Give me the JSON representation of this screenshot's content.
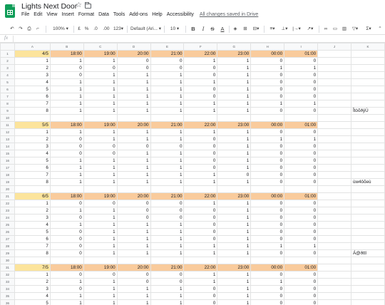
{
  "app": {
    "title": "Lights Next Door",
    "saved_status": "All changes saved in Drive",
    "menu": [
      "File",
      "Edit",
      "View",
      "Insert",
      "Format",
      "Data",
      "Tools",
      "Add-ons",
      "Help",
      "Accessibility"
    ]
  },
  "toolbar": {
    "zoom": "100%",
    "currency": "£",
    "percent": "%",
    "dec_less": ".0",
    "dec_more": ".00",
    "more_formats": "123",
    "font": "Default (Ari...",
    "font_size": "10",
    "bold": "B",
    "italic": "I",
    "strike": "S",
    "text_color": "A"
  },
  "formula_bar": {
    "label": "fx",
    "value": ""
  },
  "columns": [
    "A",
    "B",
    "C",
    "D",
    "E",
    "F",
    "G",
    "H",
    "I",
    "J",
    "K"
  ],
  "rows": [
    [
      "4/5",
      "18:00",
      "19:00",
      "20:00",
      "21:00",
      "22:00",
      "23:00",
      "00:00",
      "01:00",
      "",
      ""
    ],
    [
      "1",
      "1",
      "1",
      "0",
      "0",
      "1",
      "1",
      "0",
      "0",
      "",
      ""
    ],
    [
      "2",
      "0",
      "0",
      "0",
      "0",
      "0",
      "1",
      "1",
      "1",
      "",
      ""
    ],
    [
      "3",
      "0",
      "1",
      "1",
      "1",
      "0",
      "1",
      "0",
      "0",
      "",
      ""
    ],
    [
      "4",
      "1",
      "1",
      "1",
      "1",
      "1",
      "1",
      "0",
      "0",
      "",
      ""
    ],
    [
      "5",
      "1",
      "1",
      "1",
      "1",
      "0",
      "1",
      "0",
      "0",
      "",
      ""
    ],
    [
      "6",
      "1",
      "1",
      "1",
      "1",
      "0",
      "1",
      "0",
      "0",
      "",
      ""
    ],
    [
      "7",
      "1",
      "1",
      "1",
      "1",
      "1",
      "1",
      "1",
      "1",
      "",
      ""
    ],
    [
      "8",
      "1",
      "1",
      "1",
      "1",
      "1",
      "1",
      "0",
      "0",
      "",
      "ÎtòõðÿÙ"
    ],
    [
      "",
      "",
      "",
      "",
      "",
      "",
      "",
      "",
      "",
      "",
      ""
    ],
    [
      "5/5",
      "18:00",
      "19:00",
      "20:00",
      "21:00",
      "22:00",
      "23:00",
      "00:00",
      "01:00",
      "",
      ""
    ],
    [
      "1",
      "1",
      "1",
      "1",
      "1",
      "1",
      "1",
      "0",
      "0",
      "",
      ""
    ],
    [
      "2",
      "0",
      "1",
      "1",
      "1",
      "0",
      "1",
      "1",
      "1",
      "",
      ""
    ],
    [
      "3",
      "0",
      "0",
      "0",
      "0",
      "0",
      "1",
      "0",
      "0",
      "",
      ""
    ],
    [
      "4",
      "0",
      "0",
      "1",
      "1",
      "0",
      "1",
      "0",
      "0",
      "",
      ""
    ],
    [
      "5",
      "1",
      "1",
      "1",
      "1",
      "0",
      "1",
      "0",
      "0",
      "",
      ""
    ],
    [
      "6",
      "1",
      "1",
      "1",
      "1",
      "0",
      "1",
      "0",
      "0",
      "",
      ""
    ],
    [
      "7",
      "1",
      "1",
      "1",
      "1",
      "1",
      "0",
      "0",
      "0",
      "",
      ""
    ],
    [
      "8",
      "1",
      "1",
      "1",
      "1",
      "1",
      "1",
      "0",
      "0",
      "",
      "ùw4ôõeù"
    ],
    [
      "",
      "",
      "",
      "",
      "",
      "",
      "",
      "",
      "",
      "",
      ""
    ],
    [
      "6/5",
      "18:00",
      "19:00",
      "20:00",
      "21:00",
      "22:00",
      "23:00",
      "00:00",
      "01:00",
      "",
      ""
    ],
    [
      "1",
      "0",
      "0",
      "0",
      "0",
      "1",
      "1",
      "0",
      "0",
      "",
      ""
    ],
    [
      "2",
      "1",
      "1",
      "0",
      "0",
      "0",
      "1",
      "0",
      "0",
      "",
      ""
    ],
    [
      "3",
      "0",
      "1",
      "0",
      "0",
      "0",
      "1",
      "0",
      "0",
      "",
      ""
    ],
    [
      "4",
      "1",
      "1",
      "1",
      "1",
      "0",
      "1",
      "0",
      "0",
      "",
      ""
    ],
    [
      "5",
      "0",
      "1",
      "1",
      "1",
      "0",
      "1",
      "0",
      "0",
      "",
      ""
    ],
    [
      "6",
      "0",
      "1",
      "1",
      "1",
      "0",
      "1",
      "0",
      "0",
      "",
      ""
    ],
    [
      "7",
      "0",
      "1",
      "1",
      "1",
      "1",
      "1",
      "1",
      "1",
      "",
      ""
    ],
    [
      "8",
      "0",
      "1",
      "1",
      "1",
      "1",
      "1",
      "0",
      "0",
      "",
      "Á@ðttl"
    ],
    [
      "",
      "",
      "",
      "",
      "",
      "",
      "",
      "",
      "",
      "",
      ""
    ],
    [
      "7/5",
      "18:00",
      "19:00",
      "20:00",
      "21:00",
      "22:00",
      "23:00",
      "00:00",
      "01:00",
      "",
      ""
    ],
    [
      "1",
      "0",
      "0",
      "0",
      "0",
      "1",
      "1",
      "0",
      "0",
      "",
      ""
    ],
    [
      "2",
      "1",
      "1",
      "0",
      "0",
      "1",
      "1",
      "1",
      "0",
      "",
      ""
    ],
    [
      "3",
      "0",
      "1",
      "1",
      "1",
      "0",
      "1",
      "0",
      "0",
      "",
      ""
    ],
    [
      "4",
      "1",
      "1",
      "1",
      "1",
      "0",
      "1",
      "0",
      "0",
      "",
      ""
    ],
    [
      "5",
      "1",
      "1",
      "1",
      "1",
      "0",
      "1",
      "0",
      "0",
      "",
      ""
    ]
  ],
  "colors": {
    "date_header": "#fce49c",
    "hour_header": "#f9cb9c",
    "logo": "#0f9d58"
  }
}
